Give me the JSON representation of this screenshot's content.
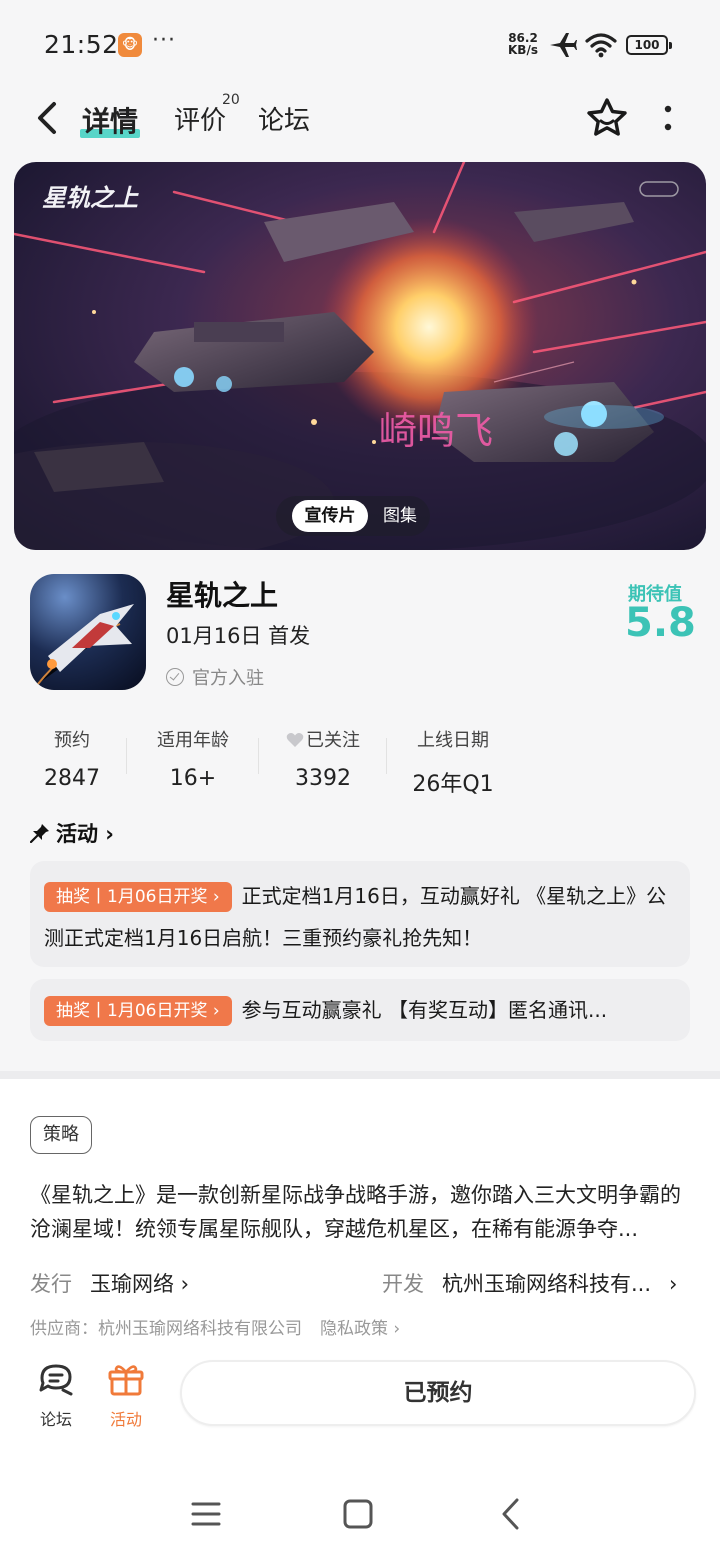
{
  "status_bar": {
    "time": "21:52",
    "app_badge": "🐵",
    "dots": "···",
    "net_speed_top": "86.2",
    "net_speed_bottom": "KB/s",
    "battery": "100"
  },
  "nav": {
    "tabs": [
      {
        "label": "详情",
        "active": true
      },
      {
        "label": "评价",
        "badge": "20"
      },
      {
        "label": "论坛"
      }
    ]
  },
  "banner": {
    "logo_text": "星轨之上",
    "watermark": "崎鸣飞",
    "pill_active": "宣传片",
    "pill_other": "图集"
  },
  "game": {
    "title": "星轨之上",
    "release": "01月16日 首发",
    "official": "官方入驻",
    "expect_label": "期待值",
    "expect_value": "5.8"
  },
  "stats": [
    {
      "label": "预约",
      "value": "2847"
    },
    {
      "label": "适用年龄",
      "value": "16+"
    },
    {
      "label": "已关注",
      "value": "3392"
    },
    {
      "label": "上线日期",
      "value": "26年Q1"
    }
  ],
  "activity": {
    "header": "活动 ›",
    "cards": [
      {
        "tag": "抽奖丨1月06日开奖 ›",
        "text": "正式定档1月16日，互动赢好礼 《星轨之上》公测正式定档1月16日启航！三重预约豪礼抢先知！"
      },
      {
        "tag": "抽奖丨1月06日开奖 ›",
        "text": "参与互动赢豪礼 【有奖互动】匿名通讯..."
      }
    ]
  },
  "info": {
    "tag": "策略",
    "description": "《星轨之上》是一款创新星际战争战略手游，邀你踏入三大文明争霸的沧澜星域！统领专属星际舰队，穿越危机星区，在稀有能源争夺...",
    "publisher_key": "发行",
    "publisher": "玉瑜网络 ›",
    "developer_key": "开发",
    "developer": "杭州玉瑜网络科技有...",
    "developer_arrow": "›",
    "supplier": "供应商：杭州玉瑜网络科技有限公司",
    "privacy": "隐私政策 ›"
  },
  "bottom_bar": {
    "forum_label": "论坛",
    "activity_label": "活动",
    "reserve_label": "已预约"
  },
  "colors": {
    "accent_teal": "#3cc3b6",
    "lottery_orange": "#f0784a",
    "activity_orange": "#f07a3a"
  }
}
